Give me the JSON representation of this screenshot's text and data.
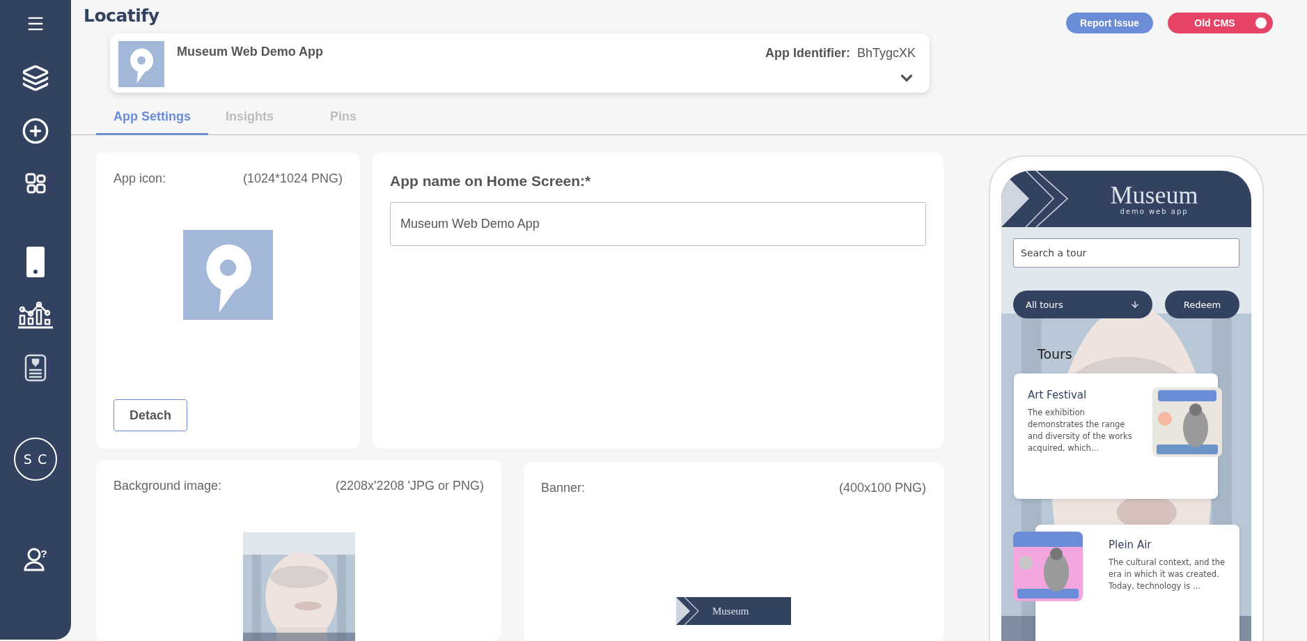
{
  "brand": {
    "logo": "Locatify"
  },
  "sidebar": {
    "avatar": "S C",
    "help_mark": "?"
  },
  "header_buttons": [
    {
      "label": "Report Issue",
      "kind": "button"
    },
    {
      "label": "Old CMS",
      "kind": "toggle",
      "on": true
    }
  ],
  "app_card": {
    "name": "Museum Web Demo App",
    "identifier_label": "App Identifier:",
    "identifier": "BhTygcXK",
    "expanded": false
  },
  "tabs": [
    {
      "label": "App Settings",
      "selected": true
    },
    {
      "label": "Insights",
      "selected": false
    },
    {
      "label": "Pins",
      "selected": false
    }
  ],
  "app_icon_card": {
    "label": "App icon:",
    "spec": "(1024*1024 PNG)",
    "button": "Detach"
  },
  "app_name_card": {
    "label": "App name on Home Screen:*",
    "value": "Museum Web Demo App"
  },
  "background_card": {
    "label": "Background image:",
    "spec": "(2208x'2208 'JPG or PNG)"
  },
  "banner_card": {
    "label": "Banner:",
    "spec": "(400x100 PNG)",
    "banner_title": "Museum"
  },
  "phone_preview": {
    "title": "Museum",
    "subtitle": "demo web app",
    "search_placeholder": "Search a tour",
    "filter": "All tours",
    "redeem": "Redeem",
    "section": "Tours",
    "tours": [
      {
        "title": "Art Festival",
        "description": "The exhibition demonstrates the range and diversity of the works acquired, which...",
        "kind": "standard"
      },
      {
        "title": "Plein Air",
        "description": "The cultural context, and the era in which it was created. Today, technology is ...",
        "kind": "reversed"
      }
    ]
  }
}
